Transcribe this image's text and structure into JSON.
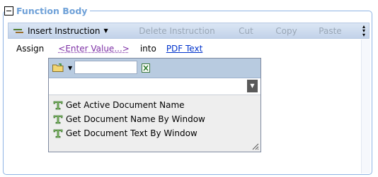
{
  "section": {
    "title": "Function Body"
  },
  "toolbar": {
    "insert_label": "Insert Instruction",
    "delete_label": "Delete Instruction",
    "cut_label": "Cut",
    "copy_label": "Copy",
    "paste_label": "Paste"
  },
  "statement": {
    "keyword": "Assign",
    "value_link": "<Enter Value...>",
    "connector": "into",
    "target_link": "PDF Text"
  },
  "picker": {
    "search_value": "",
    "select_value": "",
    "items": [
      {
        "label": "Get Active Document Name",
        "icon": "function-t-icon"
      },
      {
        "label": "Get Document Name By Window",
        "icon": "function-t-icon"
      },
      {
        "label": "Get Document Text By Window",
        "icon": "function-t-icon"
      }
    ]
  },
  "colors": {
    "legend_text": "#6fa1d8",
    "group_border": "#8fb4e4",
    "value_link": "#7d2fa5",
    "target_link": "#0033cc"
  }
}
